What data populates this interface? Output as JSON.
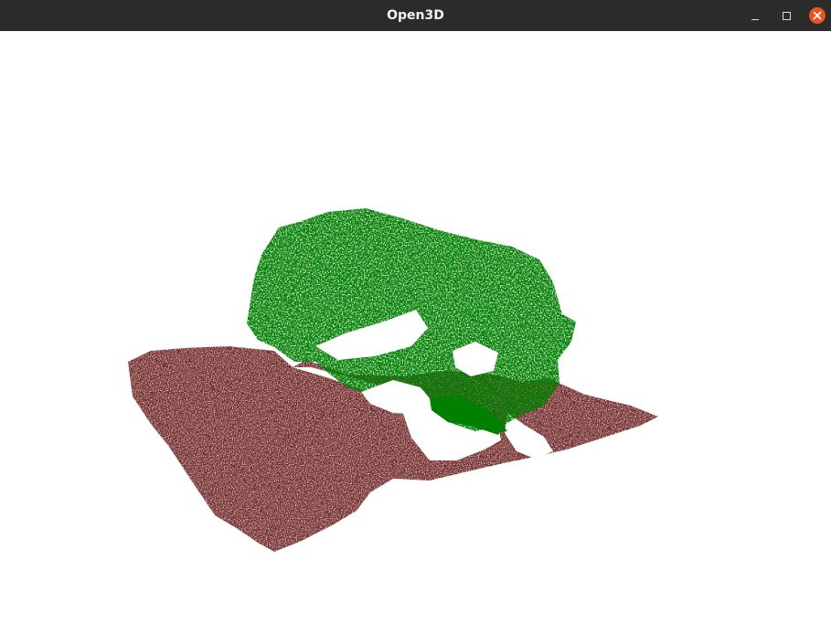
{
  "window": {
    "title": "Open3D",
    "controls": {
      "minimize_icon": "minimize-icon",
      "maximize_icon": "maximize-icon",
      "close_icon": "close-icon"
    }
  },
  "viewport": {
    "background": "#ffffff",
    "point_clouds": [
      {
        "color": "#007f00"
      },
      {
        "color": "#722a2a"
      }
    ]
  },
  "colors": {
    "titlebar": "#2b2b2b",
    "close_button": "#e95420",
    "title_text": "#f2f2f2"
  }
}
